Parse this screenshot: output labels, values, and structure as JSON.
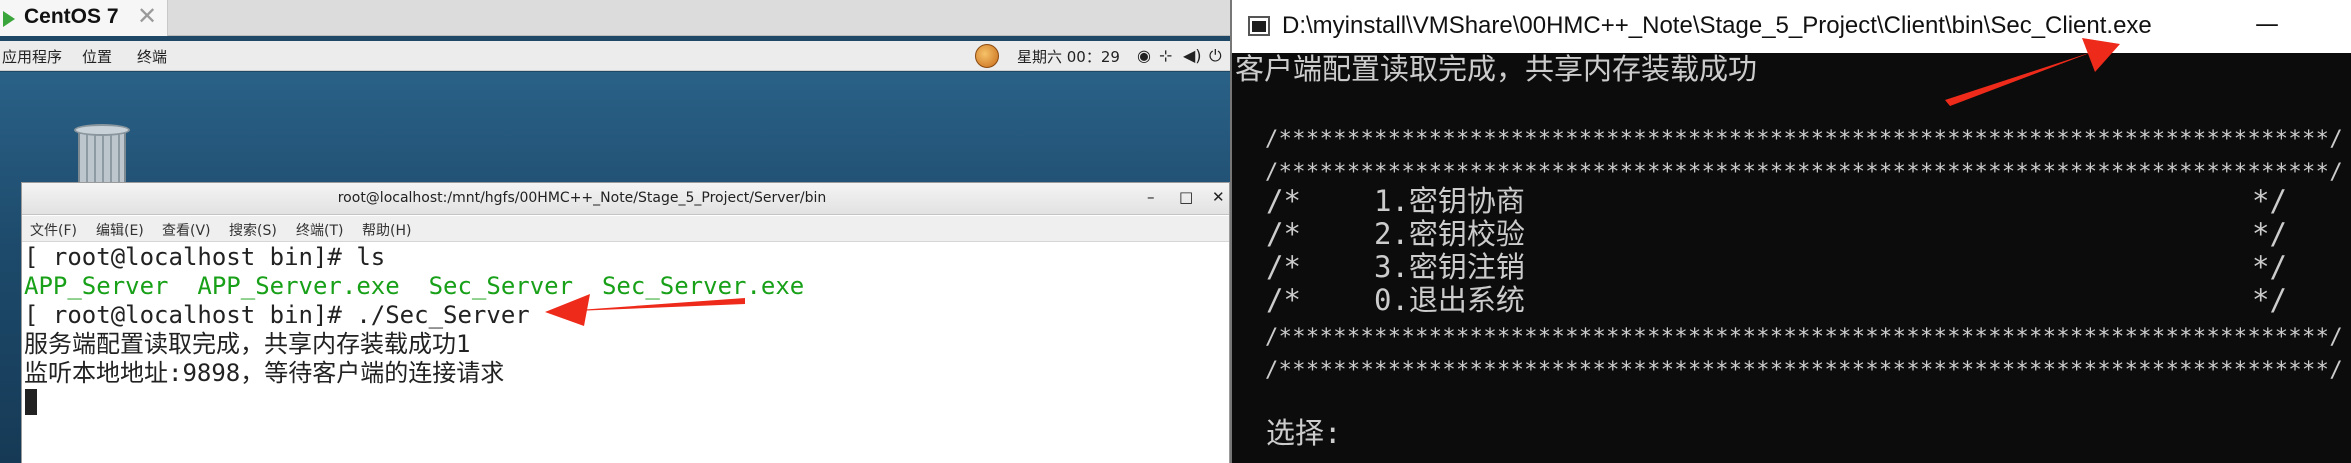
{
  "vm": {
    "tab_title": "CentOS 7",
    "tab_close": "✕",
    "gnome_menu": [
      "应用程序",
      "位置",
      "终端"
    ],
    "clock": "星期六 00：29",
    "tray_icons": [
      "accessibility-icon",
      "network-icon",
      "volume-icon",
      "power-icon"
    ]
  },
  "terminal": {
    "title": "root@localhost:/mnt/hgfs/00HMC++_Note/Stage_5_Project/Server/bin",
    "window_buttons": [
      "–",
      "□",
      "✕"
    ],
    "menu": [
      "文件(F)",
      "编辑(E)",
      "查看(V)",
      "搜索(S)",
      "终端(T)",
      "帮助(H)"
    ],
    "lines": [
      "[ root@localhost bin]# ls",
      "APP_Server  APP_Server.exe  Sec_Server  Sec_Server.exe",
      "[ root@localhost bin]# ./Sec_Server",
      "服务端配置读取完成，共享内存装载成功1",
      "监听本地地址:9898，等待客户端的连接请求"
    ]
  },
  "console": {
    "title": "D:\\myinstall\\VMShare\\00HMC++_Note\\Stage_5_Project\\Client\\bin\\Sec_Client.exe",
    "minimize": "—",
    "status": "客户端配置读取完成，共享内存装载成功",
    "border_line": "/*****************************************************************************/",
    "menu_items": [
      {
        "open": "/*",
        "label": "1.密钥协商",
        "close": "*/"
      },
      {
        "open": "/*",
        "label": "2.密钥校验",
        "close": "*/"
      },
      {
        "open": "/*",
        "label": "3.密钥注销",
        "close": "*/"
      },
      {
        "open": "/*",
        "label": "0.退出系统",
        "close": "*/"
      }
    ],
    "prompt": "选择:"
  },
  "colors": {
    "arrow": "#ee2a1a",
    "green_text": "#18a018",
    "console_bg": "#0c0c0c",
    "console_text": "#cccccc"
  }
}
